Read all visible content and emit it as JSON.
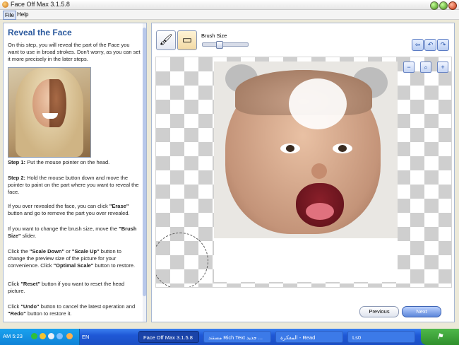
{
  "window": {
    "title": "Face Off Max  3.1.5.8"
  },
  "menu": {
    "items": [
      "File",
      "Help"
    ]
  },
  "left_panel": {
    "title": "Reveal the Face",
    "intro": "On this step, you will reveal the part of the Face you want to use in broad strokes. Don't worry, as you can set it more precisely in the later steps.",
    "step1_label": "Step 1:",
    "step1_text": " Put the mouse pointer on the head.",
    "step2_label": "Step 2:",
    "step2_text": " Hold the mouse button down and move the pointer to paint on the part where you want to reveal the face.",
    "erase_pre": "If you over revealed the face, you can click ",
    "erase_bold": "\"Erase\"",
    "erase_post": " button and go to remove the part you over revealed.",
    "brush_pre": "If you want to change the brush size, move the ",
    "brush_bold": "\"Brush Size\"",
    "brush_post": " slider.",
    "scale_pre": "Click the ",
    "scale_down": "\"Scale Down\"",
    "scale_or": " or ",
    "scale_up": "\"Scale Up\"",
    "scale_mid": " button to change the preview size of the picture for your convenience. Click ",
    "scale_opt": "\"Optimal Scale\"",
    "scale_post": " button to restore.",
    "reset_pre": "Click ",
    "reset_bold": "\"Reset\"",
    "reset_post": " button if you want to reset the head picture.",
    "undo_pre": "Click ",
    "undo_bold": "\"Undo\"",
    "undo_mid": " button to cancel the latest operation and ",
    "redo_bold": "\"Redo\"",
    "redo_post": " button to restore it."
  },
  "toolbar": {
    "brush_tool_icon": "brush-icon",
    "eraser_tool_icon": "eraser-icon",
    "brush_size_label": "Brush Size",
    "brush_size_level": 0.35
  },
  "buttons": {
    "previous": "Previous",
    "next": "Next"
  },
  "taskbar": {
    "clock": "AM 5:23",
    "language": "EN",
    "tasks": [
      "Face Off Max  3.1.5.8",
      "مستند Rich Text جديد ...",
      "المفكرة - Read",
      "Ls0"
    ]
  },
  "colors": {
    "accent": "#2c5a9e",
    "taskbar": "#1f58d6",
    "start": "#2f8f2c"
  }
}
